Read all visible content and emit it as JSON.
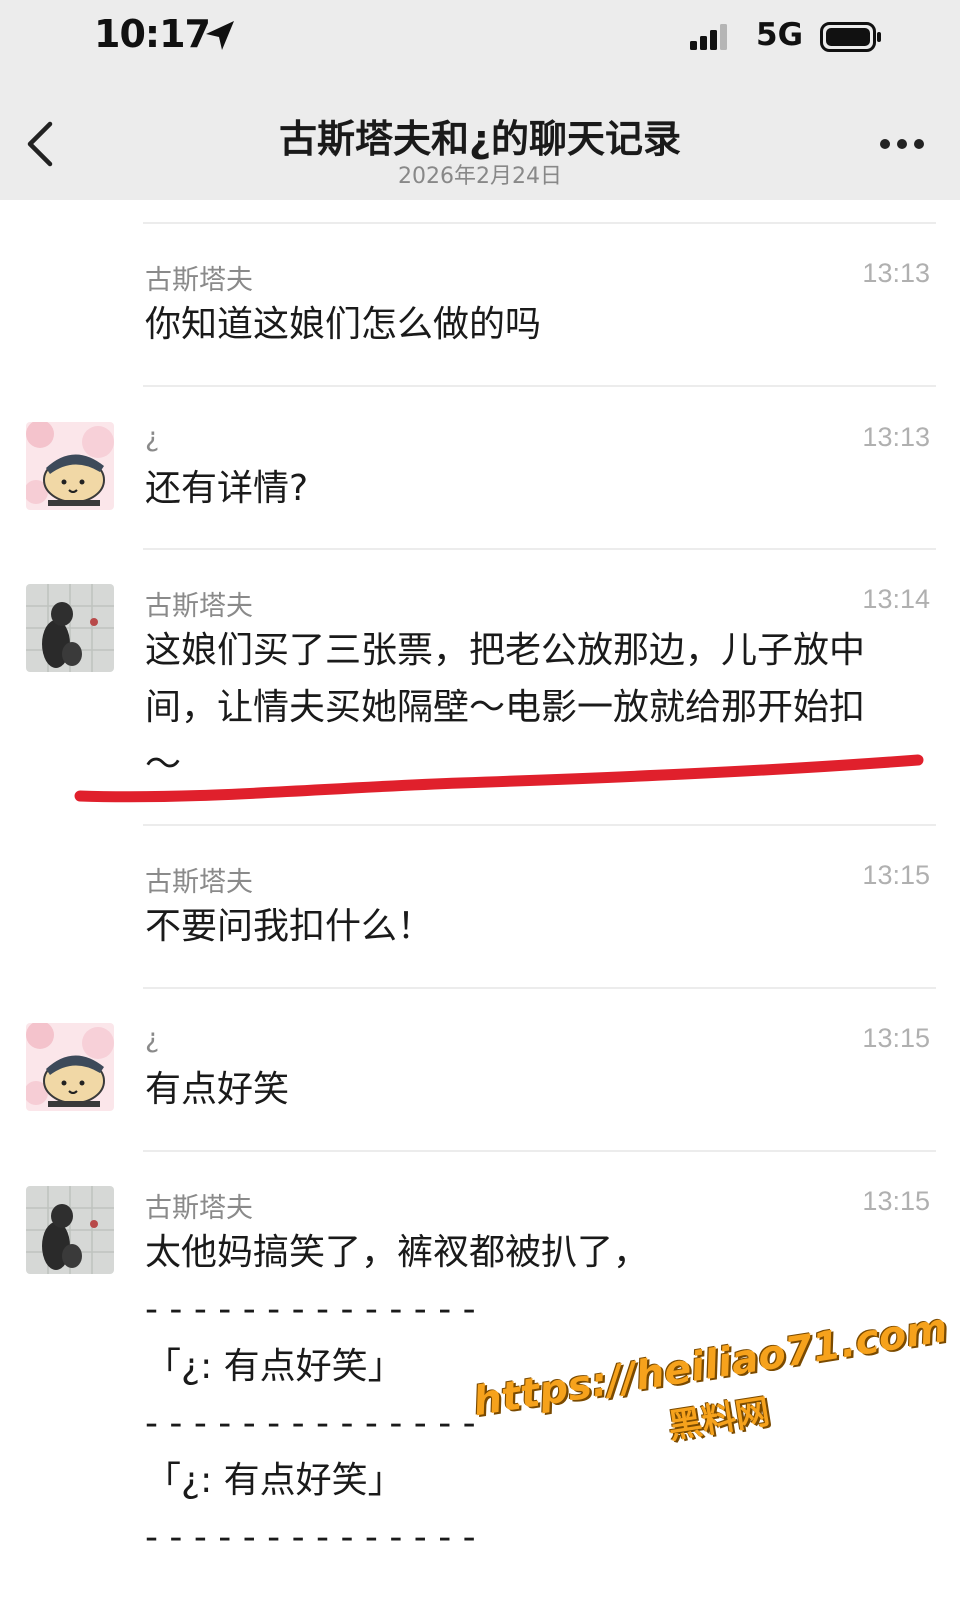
{
  "status_bar": {
    "time": "10:17",
    "network": "5G",
    "icons": [
      "location-arrow-icon",
      "signal-icon",
      "battery-icon"
    ]
  },
  "header": {
    "title": "古斯塔夫和¿的聊天记录",
    "date": "2026年2月24日",
    "icons": [
      "back-chevron-icon",
      "more-icon"
    ]
  },
  "messages": [
    {
      "sender": "古斯塔夫",
      "time": "13:13",
      "avatar": "none",
      "lines": [
        "你知道这娘们怎么做的吗"
      ]
    },
    {
      "sender": "¿",
      "time": "13:13",
      "avatar": "cartoon-avatar",
      "lines": [
        "还有详情?"
      ]
    },
    {
      "sender": "古斯塔夫",
      "time": "13:14",
      "avatar": "photo-avatar",
      "lines": [
        "这娘们买了三张票，把老公放那边，儿子放中",
        "间，让情夫买她隔壁～电影一放就给那开始扣",
        "～"
      ]
    },
    {
      "sender": "古斯塔夫",
      "time": "13:15",
      "avatar": "none",
      "lines": [
        "不要问我扣什么！"
      ]
    },
    {
      "sender": "¿",
      "time": "13:15",
      "avatar": "cartoon-avatar",
      "lines": [
        "有点好笑"
      ]
    },
    {
      "sender": "古斯塔夫",
      "time": "13:15",
      "avatar": "photo-avatar",
      "lines": [
        "太他妈搞笑了，裤衩都被扒了，",
        "- - - - - - - - - - - - - -",
        "「¿: 有点好笑」",
        "- - - - - - - - - - - - - -",
        "「¿: 有点好笑」",
        "- - - - - - - - - - - - - -"
      ]
    }
  ],
  "annotation": {
    "underline_color": "#e0202c"
  },
  "watermark": {
    "url": "https://heiliao71.com",
    "name": "黑料网",
    "color": "#f6a21c"
  },
  "colors": {
    "bar_bg": "#ececec",
    "muted_text": "#8a8a8a",
    "time_text": "#b0b0b0"
  }
}
